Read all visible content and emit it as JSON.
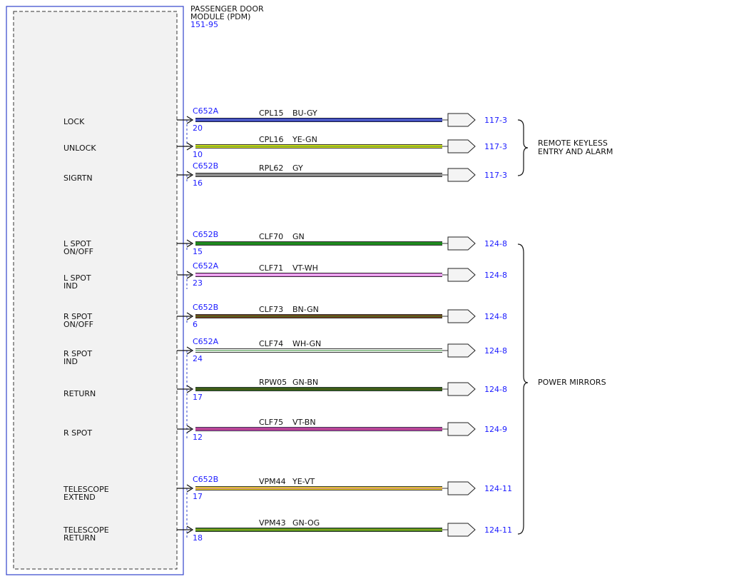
{
  "module": {
    "name_line1": "PASSENGER DOOR",
    "name_line2": "MODULE (PDM)",
    "ref": "151-95"
  },
  "groups": {
    "remote": {
      "line1": "REMOTE KEYLESS",
      "line2": "ENTRY AND ALARM"
    },
    "mirrors": {
      "line1": "POWER MIRRORS"
    }
  },
  "circuits": [
    {
      "func": [
        "LOCK"
      ],
      "connector": "C652A",
      "pin": "20",
      "circuit": "CPL15",
      "color_code": "BU-GY",
      "wire_color": "#1f2fd0",
      "stripe_color": "#9aa0a8",
      "dest": "117-3"
    },
    {
      "func": [
        "UNLOCK"
      ],
      "connector": "",
      "pin": "10",
      "circuit": "CPL16",
      "color_code": "YE-GN",
      "wire_color": "#e8e51a",
      "stripe_color": "#2e8b2e",
      "dest": "117-3"
    },
    {
      "func": [
        "SIGRTN"
      ],
      "connector": "C652B",
      "pin": "16",
      "circuit": "RPL62",
      "color_code": "GY",
      "wire_color": "#8a8a8a",
      "stripe_color": "",
      "dest": "117-3"
    },
    {
      "func": [
        "L SPOT",
        "ON/OFF"
      ],
      "connector": "C652B",
      "pin": "15",
      "circuit": "CLF70",
      "color_code": "GN",
      "wire_color": "#1f8a1f",
      "stripe_color": "",
      "dest": "124-8"
    },
    {
      "func": [
        "L SPOT",
        "IND"
      ],
      "connector": "C652A",
      "pin": "23",
      "circuit": "CLF71",
      "color_code": "VT-WH",
      "wire_color": "#dd6ee0",
      "stripe_color": "#ffffff",
      "dest": "124-8"
    },
    {
      "func": [
        "R SPOT",
        "ON/OFF"
      ],
      "connector": "C652B",
      "pin": "6",
      "circuit": "CLF73",
      "color_code": "BN-GN",
      "wire_color": "#7a3a14",
      "stripe_color": "#2e8b2e",
      "dest": "124-8"
    },
    {
      "func": [
        "R SPOT",
        "IND"
      ],
      "connector": "C652A",
      "pin": "24",
      "circuit": "CLF74",
      "color_code": "WH-GN",
      "wire_color": "#ffffff",
      "stripe_color": "#2e8b2e",
      "dest": "124-8"
    },
    {
      "func": [
        "RETURN"
      ],
      "connector": "",
      "pin": "17",
      "circuit": "RPW05",
      "color_code": "GN-BN",
      "wire_color": "#2a6e1a",
      "stripe_color": "#6a3a14",
      "dest": "124-8"
    },
    {
      "func": [
        "R SPOT"
      ],
      "connector": "",
      "pin": "12",
      "circuit": "CLF75",
      "color_code": "VT-BN",
      "wire_color": "#d84ad8",
      "stripe_color": "#7a3a14",
      "dest": "124-9"
    },
    {
      "func": [
        "TELESCOPE",
        "EXTEND"
      ],
      "connector": "C652B",
      "pin": "17",
      "circuit": "VPM44",
      "color_code": "YE-VT",
      "wire_color": "#ecd41c",
      "stripe_color": "#c060c0",
      "dest": "124-11"
    },
    {
      "func": [
        "TELESCOPE",
        "RETURN"
      ],
      "connector": "",
      "pin": "18",
      "circuit": "VPM43",
      "color_code": "GN-OG",
      "wire_color": "#3a8a1a",
      "stripe_color": "#d0b020",
      "dest": "124-11"
    }
  ],
  "colors": {
    "module_border": "#3344cc",
    "module_fill": "#f2f2f2",
    "link_text": "#1a1aff",
    "connector_dash": "#3344cc"
  }
}
